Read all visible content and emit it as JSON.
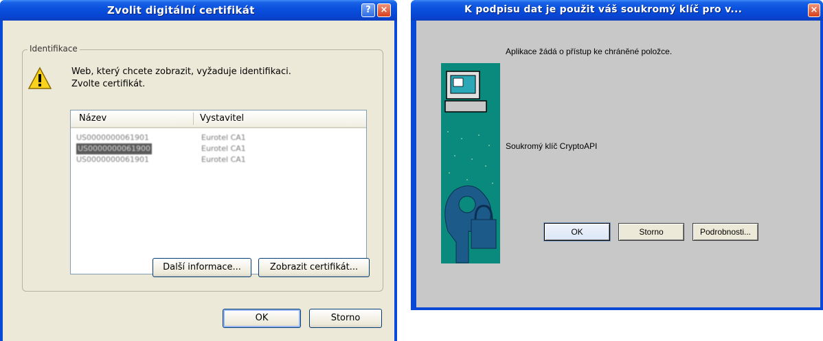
{
  "dialog1": {
    "title": "Zvolit digitální certifikát",
    "help_glyph": "?",
    "close_glyph": "×",
    "group_label": "Identifikace",
    "message_line1": "Web, který chcete zobrazit, vyžaduje identifikaci.",
    "message_line2": "Zvolte certifikát.",
    "columns": [
      "Název",
      "Vystavitel"
    ],
    "rows": [
      {
        "name": "US0000000061901",
        "issuer": "Eurotel CA1"
      },
      {
        "name": "US0000000061900",
        "issuer": "Eurotel CA1"
      },
      {
        "name": "US0000000061901",
        "issuer": "Eurotel CA1"
      }
    ],
    "selected_row": 1,
    "more_info_button": "Další informace...",
    "view_cert_button": "Zobrazit certifikát...",
    "ok_button": "OK",
    "cancel_button": "Storno"
  },
  "dialog2": {
    "title": "K podpisu dat je použit váš soukromý klíč pro v...",
    "close_glyph": "×",
    "request_text": "Aplikace žádá o přístup ke chráněné položce.",
    "key_label": "Soukromý klíč CryptoAPI",
    "ok_button": "OK",
    "cancel_button": "Storno",
    "details_button": "Podrobnosti..."
  }
}
